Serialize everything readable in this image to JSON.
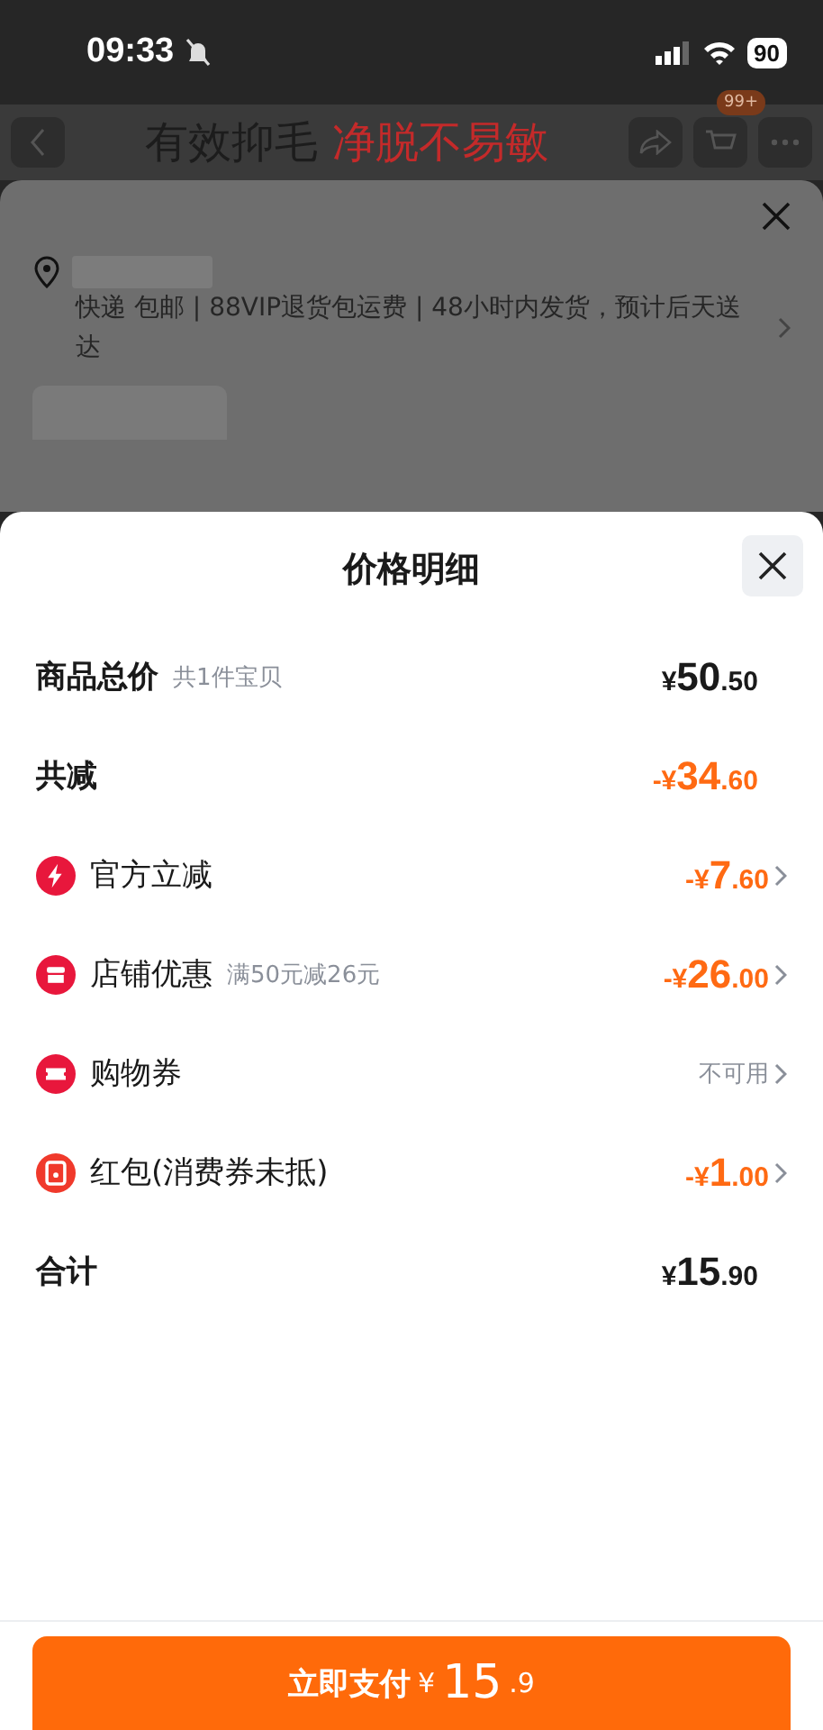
{
  "status_bar": {
    "time": "09:33",
    "battery": "90"
  },
  "page_header": {
    "title_parts": [
      {
        "text": "有效抑毛",
        "kind": "plain"
      },
      {
        "text": "净脱不易敏",
        "kind": "accent"
      }
    ],
    "cart_badge": "99+"
  },
  "order_sheet": {
    "shipping": "快递 包邮 | 88VIP退货包运费 | 48小时内发货，预计后天送达"
  },
  "price_sheet": {
    "title": "价格明细",
    "rows": [
      {
        "kind": "sum",
        "label": "商品总价",
        "note": "共1件宝贝",
        "amount": {
          "prefix": "¥",
          "main": "50",
          "fraction": ".50"
        }
      },
      {
        "kind": "reduction",
        "label": "共减",
        "amount": {
          "prefix": "-¥",
          "main": "34",
          "fraction": ".60"
        }
      },
      {
        "kind": "item",
        "label": "官方立减",
        "amount": {
          "prefix": "-¥",
          "main": "7",
          "fraction": ".60"
        }
      },
      {
        "kind": "item",
        "label": "店铺优惠",
        "note": "满50元减26元",
        "amount": {
          "prefix": "-¥",
          "main": "26",
          "fraction": ".00"
        }
      },
      {
        "kind": "item",
        "label": "购物券",
        "status": "不可用"
      },
      {
        "kind": "item",
        "label": "红包(消费券未抵)",
        "amount": {
          "prefix": "-¥",
          "main": "1",
          "fraction": ".00"
        }
      },
      {
        "kind": "sum",
        "label": "合计",
        "amount": {
          "prefix": "¥",
          "main": "15",
          "fraction": ".90"
        }
      }
    ]
  },
  "pay_button": {
    "label": "立即支付",
    "amount": {
      "prefix": "¥",
      "main": "15",
      "fraction": ".9"
    }
  }
}
